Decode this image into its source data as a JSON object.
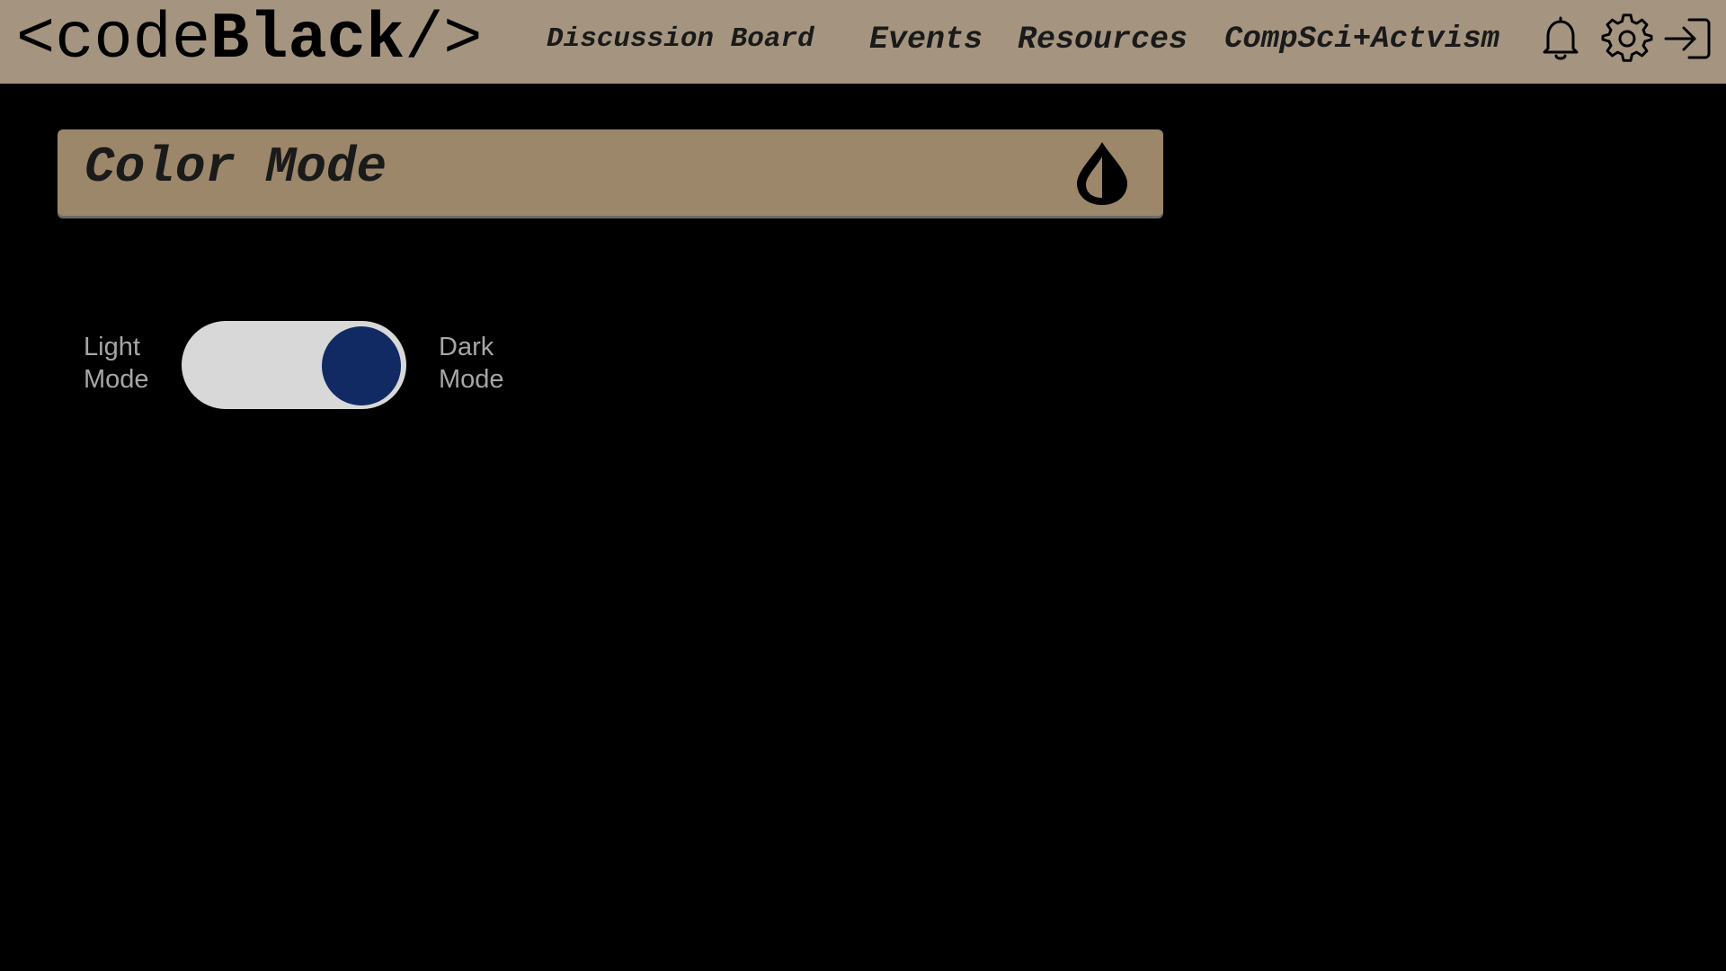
{
  "header": {
    "logo_prefix": "<code",
    "logo_bold": "Black",
    "logo_suffix": "/>",
    "nav": [
      {
        "label": "Discussion Board"
      },
      {
        "label": "Events"
      },
      {
        "label": "Resources"
      },
      {
        "label": "CompSci+Actvism"
      }
    ],
    "icons": [
      "bell-icon",
      "gear-icon",
      "logout-icon"
    ]
  },
  "section": {
    "title": "Color Mode",
    "icon": "contrast-drop-icon"
  },
  "toggle": {
    "left_label": "Light Mode",
    "right_label": "Dark Mode",
    "state": "dark",
    "knob_color": "#112a63",
    "track_color": "#d8d8d8"
  },
  "colors": {
    "header_bg": "#a59580",
    "section_bg": "#9c876a",
    "page_bg": "#000000"
  }
}
